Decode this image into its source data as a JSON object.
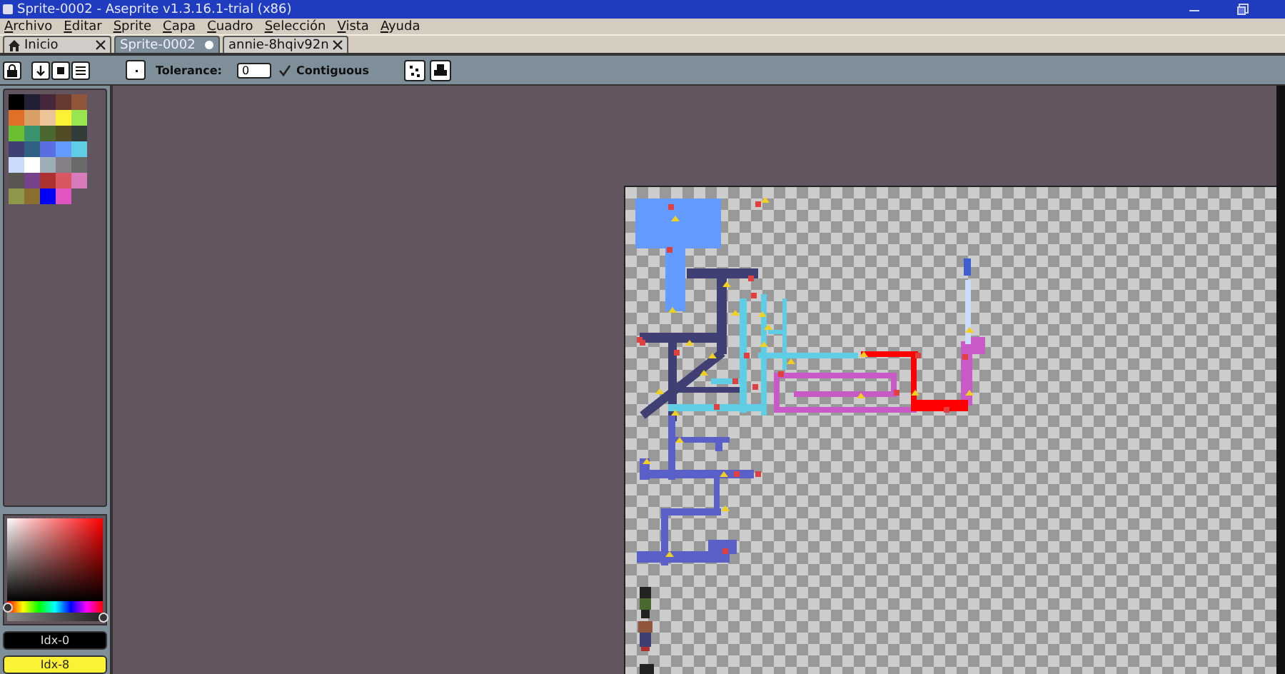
{
  "window": {
    "title": "Sprite-0002 - Aseprite v1.3.16.1-trial (x86)"
  },
  "menu": [
    "Archivo",
    "Editar",
    "Sprite",
    "Capa",
    "Cuadro",
    "Selección",
    "Vista",
    "Ayuda"
  ],
  "tabs": [
    {
      "label": "Inicio",
      "kind": "home",
      "selected": false,
      "modified": false
    },
    {
      "label": "Sprite-0002",
      "kind": "document",
      "selected": true,
      "modified": true
    },
    {
      "label": "annie-8hqiv92n",
      "kind": "document",
      "selected": false,
      "modified": false
    }
  ],
  "toolbar": {
    "tolerance_label": "Tolerance:",
    "tolerance": "0",
    "contiguous": {
      "label": "Contiguous",
      "checked": true
    }
  },
  "palette": [
    {
      "color": "#000000"
    },
    {
      "color": "#222034"
    },
    {
      "color": "#45283c"
    },
    {
      "color": "#663931"
    },
    {
      "color": "#8f563b"
    },
    {
      "color": "#df7126"
    },
    {
      "color": "#d9a066"
    },
    {
      "color": "#eec39a"
    },
    {
      "color": "#fbf236"
    },
    {
      "color": "#99e550"
    },
    {
      "color": "#6abe30"
    },
    {
      "color": "#37946e"
    },
    {
      "color": "#4b692f"
    },
    {
      "color": "#524b24"
    },
    {
      "color": "#323c39"
    },
    {
      "color": "#3f3f74"
    },
    {
      "color": "#306082"
    },
    {
      "color": "#5b6ee1"
    },
    {
      "color": "#639bff"
    },
    {
      "color": "#5fcde4"
    },
    {
      "color": "#cbdbfc"
    },
    {
      "color": "#ffffff"
    },
    {
      "color": "#9badb7"
    },
    {
      "color": "#847e87"
    },
    {
      "color": "#696a6a"
    },
    {
      "color": "#595652"
    },
    {
      "color": "#76428a"
    },
    {
      "color": "#ac3232"
    },
    {
      "color": "#d95763"
    },
    {
      "color": "#d77bba"
    },
    {
      "color": "#8f974a"
    },
    {
      "color": "#8a6f30"
    },
    {
      "color": "#0000ff"
    },
    {
      "color": "#e055c0"
    }
  ],
  "color_picker": {
    "hue": {
      "level": 0
    },
    "alpha": {
      "level": 1
    }
  },
  "color_bar": {
    "foreground": "Idx-0",
    "background": "Idx-8"
  }
}
